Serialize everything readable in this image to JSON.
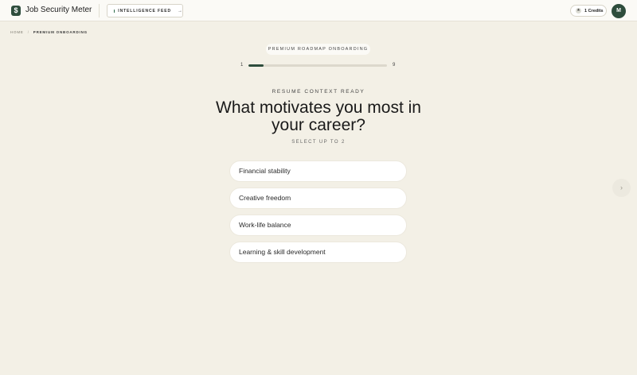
{
  "header": {
    "logo_glyph": "$",
    "app_title": "Job Security Meter",
    "intel_button": {
      "label": "INTELLIGENCE FEED",
      "arrow": "→"
    },
    "credits": {
      "icon_glyph": "★",
      "label": "1 Credits"
    },
    "avatar_initial": "M"
  },
  "breadcrumb": {
    "home": "HOME",
    "separator": "/",
    "current": "PREMIUM ONBOARDING"
  },
  "onboarding": {
    "pill_label": "PREMIUM ROADMAP ONBOARDING",
    "progress": {
      "current": "1",
      "total": "9",
      "fraction": 0.11
    },
    "eyebrow": "RESUME CONTEXT READY",
    "question": "What motivates you most in your career?",
    "hint": "SELECT UP TO 2",
    "options": [
      {
        "label": "Financial stability"
      },
      {
        "label": "Creative freedom"
      },
      {
        "label": "Work-life balance"
      },
      {
        "label": "Learning & skill development"
      }
    ],
    "next_glyph": "›"
  },
  "colors": {
    "background": "#f3f0e6",
    "brand": "#2e4d3c",
    "surface": "#ffffff"
  }
}
